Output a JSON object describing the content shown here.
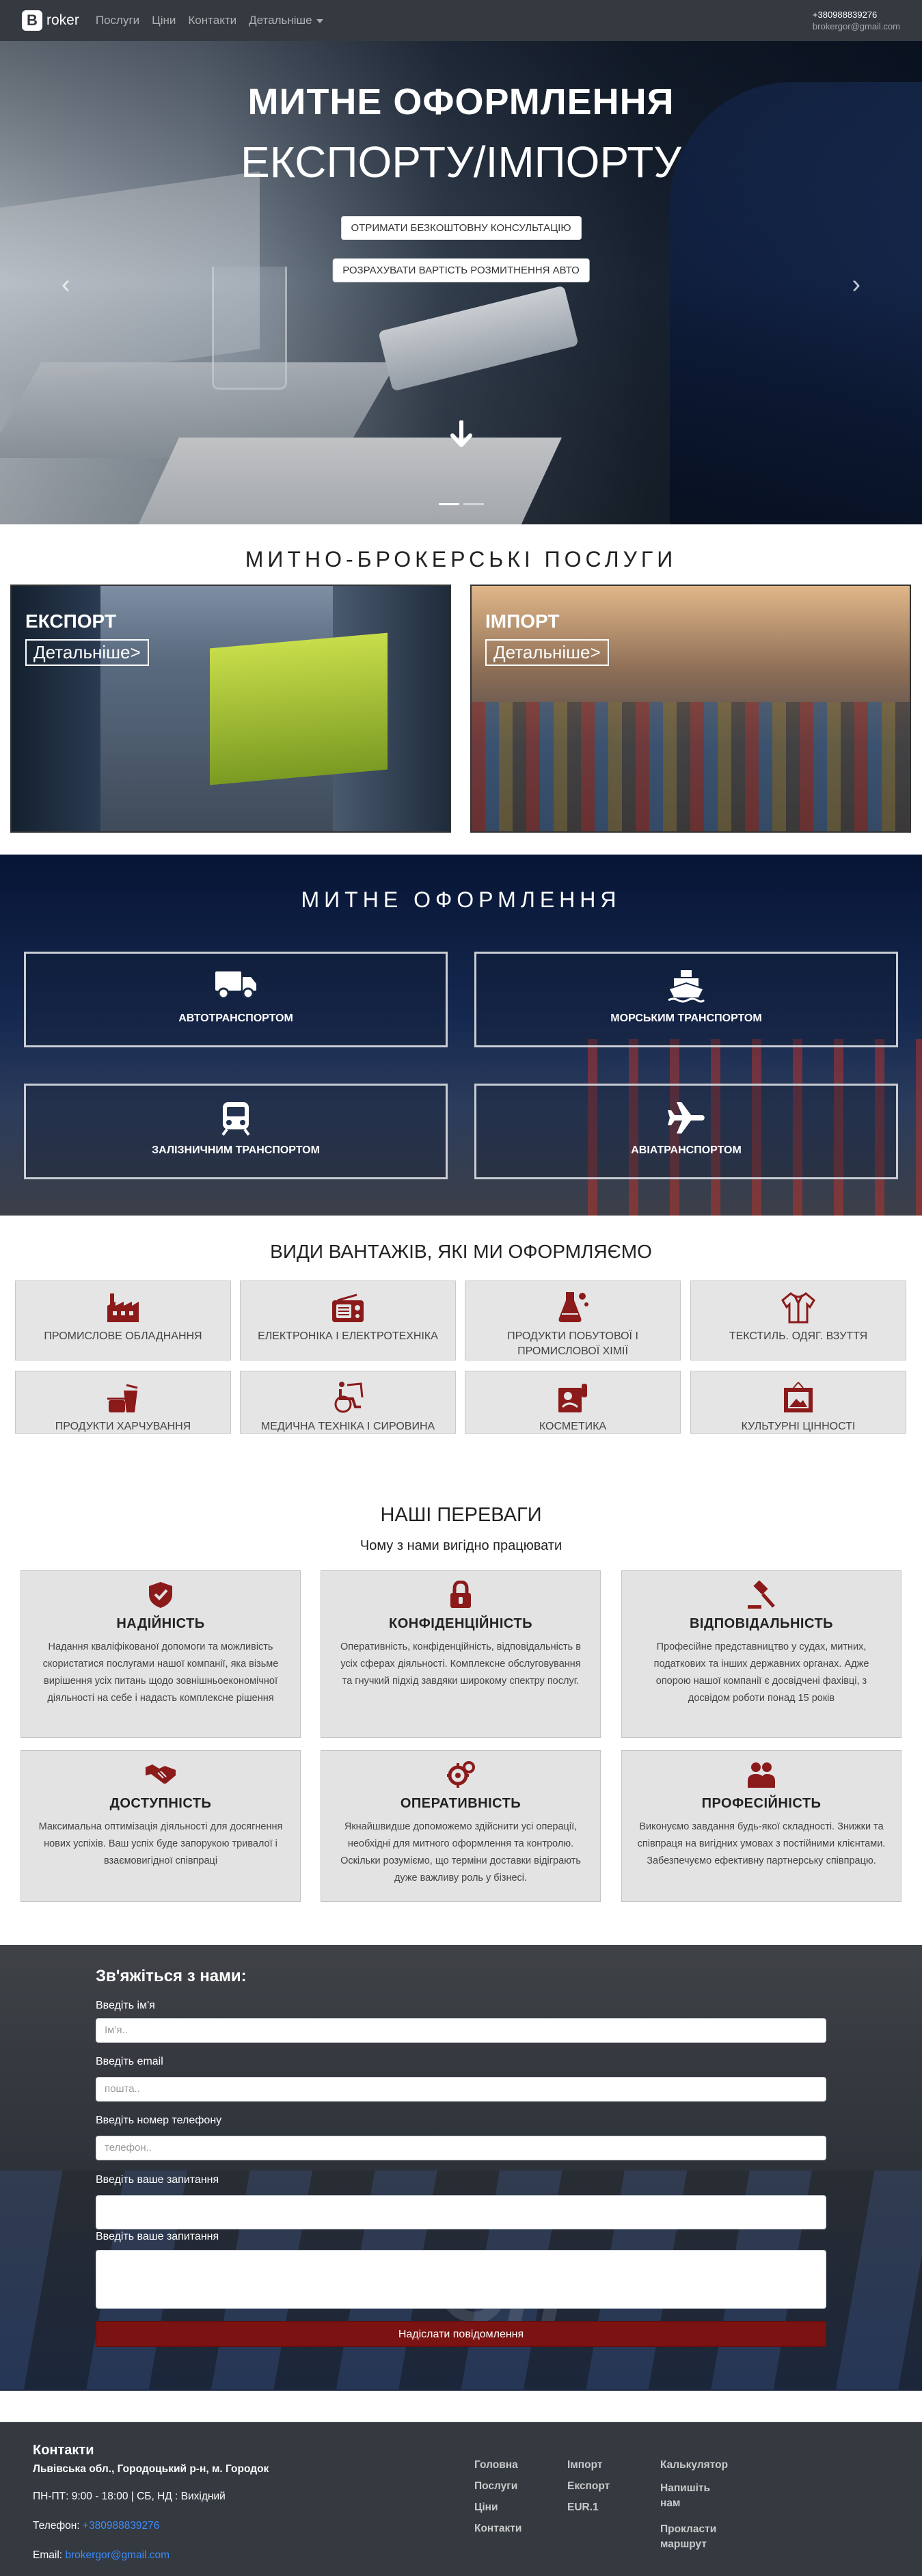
{
  "navbar": {
    "brand_letter": "B",
    "brand_text": "roker",
    "items": [
      "Послуги",
      "Ціни",
      "Контакти",
      "Детальніше"
    ],
    "phone": "+380988839276",
    "email": "brokergor@gmail.com"
  },
  "hero": {
    "title_line1": "МИТНЕ ОФОРМЛЕННЯ",
    "title_line2": "ЕКСПОРТУ/ІМПОРТУ",
    "btn_consult": "ОТРИМАТИ БЕЗКОШТОВНУ КОНСУЛЬТАЦІЮ",
    "btn_calc": "РОЗРАХУВАТИ ВАРТІСТЬ РОЗМИТНЕННЯ АВТО",
    "prev_icon": "chevron-left-icon",
    "next_icon": "chevron-right-icon",
    "scroll_icon": "arrow-down-icon"
  },
  "services": {
    "title": "МИТНО-БРОКЕРСЬКІ ПОСЛУГИ",
    "export_label": "ЕКСПОРТ",
    "export_more": "Детальніше>",
    "import_label": "ІМПОРТ",
    "import_more": "Детальніше>"
  },
  "customs": {
    "title": "МИТНЕ ОФОРМЛЕННЯ",
    "transport": [
      {
        "label": "АВТОТРАНСПОРТОМ",
        "icon": "truck-icon"
      },
      {
        "label": "МОРСЬКИМ ТРАНСПОРТОМ",
        "icon": "ship-icon"
      },
      {
        "label": "ЗАЛІЗНИЧНИМ ТРАНСПОРТОМ",
        "icon": "train-icon"
      },
      {
        "label": "АВІАТРАНСПОРТОМ",
        "icon": "plane-icon"
      }
    ]
  },
  "cargo": {
    "title": "ВИДИ ВАНТАЖІВ, ЯКІ МИ ОФОРМЛЯЄМО",
    "items": [
      {
        "label": "ПРОМИСЛОВЕ ОБЛАДНАННЯ",
        "icon": "factory-icon"
      },
      {
        "label": "ЕЛЕКТРОНІКА І ЕЛЕКТРОТЕХНІКА",
        "icon": "radio-icon"
      },
      {
        "label": "ПРОДУКТИ ПОБУТОВОЇ І ПРОМИСЛОВОЇ ХІМІЇ",
        "icon": "flask-icon"
      },
      {
        "label": "ТЕКСТИЛЬ. ОДЯГ. ВЗУТТЯ",
        "icon": "shirt-icon"
      },
      {
        "label": "ПРОДУКТИ ХАРЧУВАННЯ",
        "icon": "food-icon"
      },
      {
        "label": "МЕДИЧНА ТЕХНІКА І СИРОВИНА",
        "icon": "wheelchair-icon"
      },
      {
        "label": "КОСМЕТИКА",
        "icon": "cosmetics-icon"
      },
      {
        "label": "КУЛЬТУРНІ ЦІННОСТІ",
        "icon": "painting-icon"
      }
    ]
  },
  "advantages": {
    "title": "НАШІ ПЕРЕВАГИ",
    "subtitle": "Чому з нами вигідно працювати",
    "items": [
      {
        "title": "НАДІЙНІСТЬ",
        "icon": "shield-icon",
        "text": "Надання кваліфікованої допомоги та можливість скористатися послугами нашої компанії, яка візьме вирішення усіх питань щодо зовнішньоекономічної діяльності на себе і надасть комплексне рішення"
      },
      {
        "title": "КОНФІДЕНЦІЙНІСТЬ",
        "icon": "lock-icon",
        "text": "Оперативність, конфіденційність, відповідальність в усіх сферах діяльності. Комплексне обслуговування та гнучкий підхід завдяки широкому спектру послуг."
      },
      {
        "title": "ВІДПОВІДАЛЬНІСТЬ",
        "icon": "gavel-icon",
        "text": "Професійне представництво у судах, митних, податкових та інших державних органах. Адже опорою нашої компанії є досвідчені фахівці, з досвідом роботи понад 15 років"
      },
      {
        "title": "ДОСТУПНІСТЬ",
        "icon": "handshake-icon",
        "text": "Максимальна оптимізація діяльності для досягнення нових успіхів. Ваш успіх буде запорукою тривалої і взаємовигідної співпраці"
      },
      {
        "title": "ОПЕРАТИВНІСТЬ",
        "icon": "gears-icon",
        "text": "Якнайшвидше допоможемо здійснити усі операції, необхідні для митного оформлення та контролю. Оскільки розуміємо, що терміни доставки відіграють дуже важливу роль у бізнесі."
      },
      {
        "title": "ПРОФЕСІЙНІСТЬ",
        "icon": "users-icon",
        "text": "Виконуємо завдання будь-якої складності. Знижки та співпраця на вигідних умовах з постійними клієнтами. Забезпечуємо ефективну партнерську співпрацю."
      }
    ]
  },
  "contact": {
    "title": "Зв'яжіться з нами:",
    "name_label": "Введіть ім'я",
    "name_placeholder": "Ім'я..",
    "email_label": "Введіть email",
    "email_placeholder": "пошта..",
    "phone_label": "Введіть номер телефону",
    "phone_placeholder": "телефон..",
    "request_label": "Введіть ваше запитання",
    "request_label2": "Введіть ваше запитання",
    "submit": "Надіслати повідомлення"
  },
  "footer": {
    "title": "Контакти",
    "address": "Львівська обл., Городоцький р-н, м. Городок",
    "hours": "ПН-ПТ: 9:00 - 18:00 | СБ, НД : Вихідний",
    "phone_label": "Телефон:",
    "phone": "+380988839276",
    "email_label": "Email:",
    "email": "brokergor@gmail.com",
    "col1": [
      "Головна",
      "Послуги",
      "Ціни",
      "Контакти"
    ],
    "col2": [
      "Імпорт",
      "Експорт",
      "EUR.1"
    ],
    "col3": [
      "Калькулятор",
      "Напишіть нам",
      "Прокласти маршрут"
    ]
  },
  "colors": {
    "accent": "#8b1a1a",
    "dark": "#343a40",
    "link": "#3d8bff"
  }
}
